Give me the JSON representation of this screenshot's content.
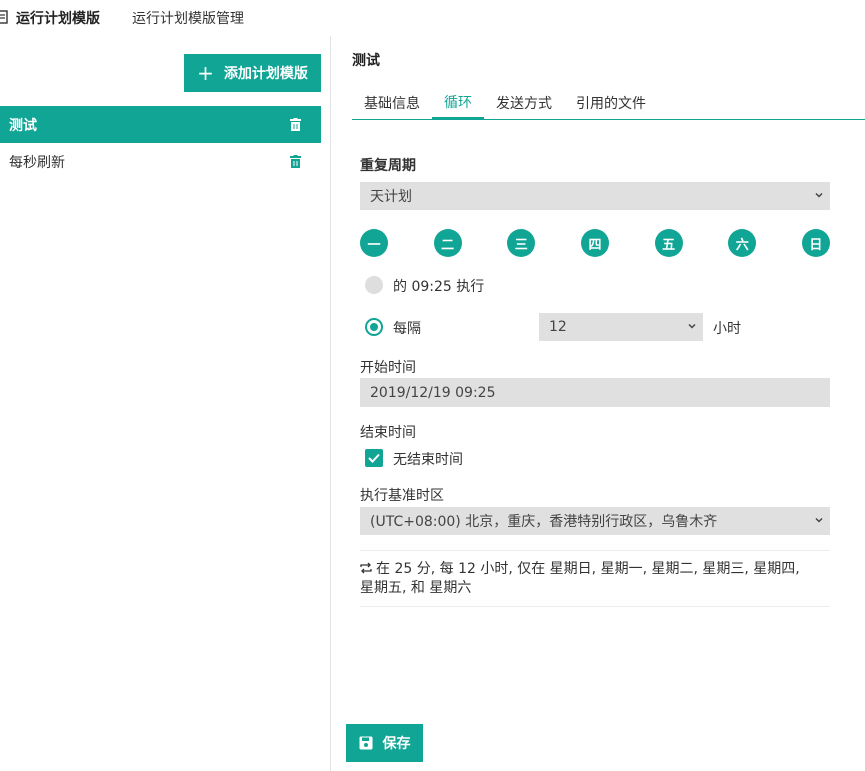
{
  "header": {
    "title": "运行计划模版",
    "nav_link": "运行计划模版管理"
  },
  "sidebar": {
    "add_button_label": "添加计划模版",
    "templates": [
      {
        "name": "测试",
        "active": true
      },
      {
        "name": "每秒刷新",
        "active": false
      }
    ]
  },
  "main": {
    "title": "测试",
    "tabs": [
      {
        "label": "基础信息",
        "active": false
      },
      {
        "label": "循环",
        "active": true
      },
      {
        "label": "发送方式",
        "active": false
      },
      {
        "label": "引用的文件",
        "active": false
      }
    ],
    "repeat": {
      "label": "重复周期",
      "selected": "天计划",
      "days": [
        "一",
        "二",
        "三",
        "四",
        "五",
        "六",
        "日"
      ],
      "at_time_option": "的 09:25 执行",
      "at_time_selected": false,
      "interval_option": "每隔",
      "interval_selected": true,
      "interval_value": "12",
      "interval_unit": "小时"
    },
    "start_time": {
      "label": "开始时间",
      "value": "2019/12/19 09:25"
    },
    "end_time": {
      "label": "结束时间",
      "no_end_label": "无结束时间",
      "no_end_checked": true
    },
    "timezone": {
      "label": "执行基准时区",
      "selected": "(UTC+08:00) 北京，重庆，香港特别行政区，乌鲁木齐"
    },
    "summary": {
      "line1": "在 25 分, 每 12 小时, 仅在 星期日, 星期一, 星期二, 星期三, 星期四,",
      "line2": "星期五, 和 星期六"
    },
    "save_label": "保存"
  },
  "colors": {
    "accent": "#10a595",
    "field_bg": "#e0e0e0"
  }
}
